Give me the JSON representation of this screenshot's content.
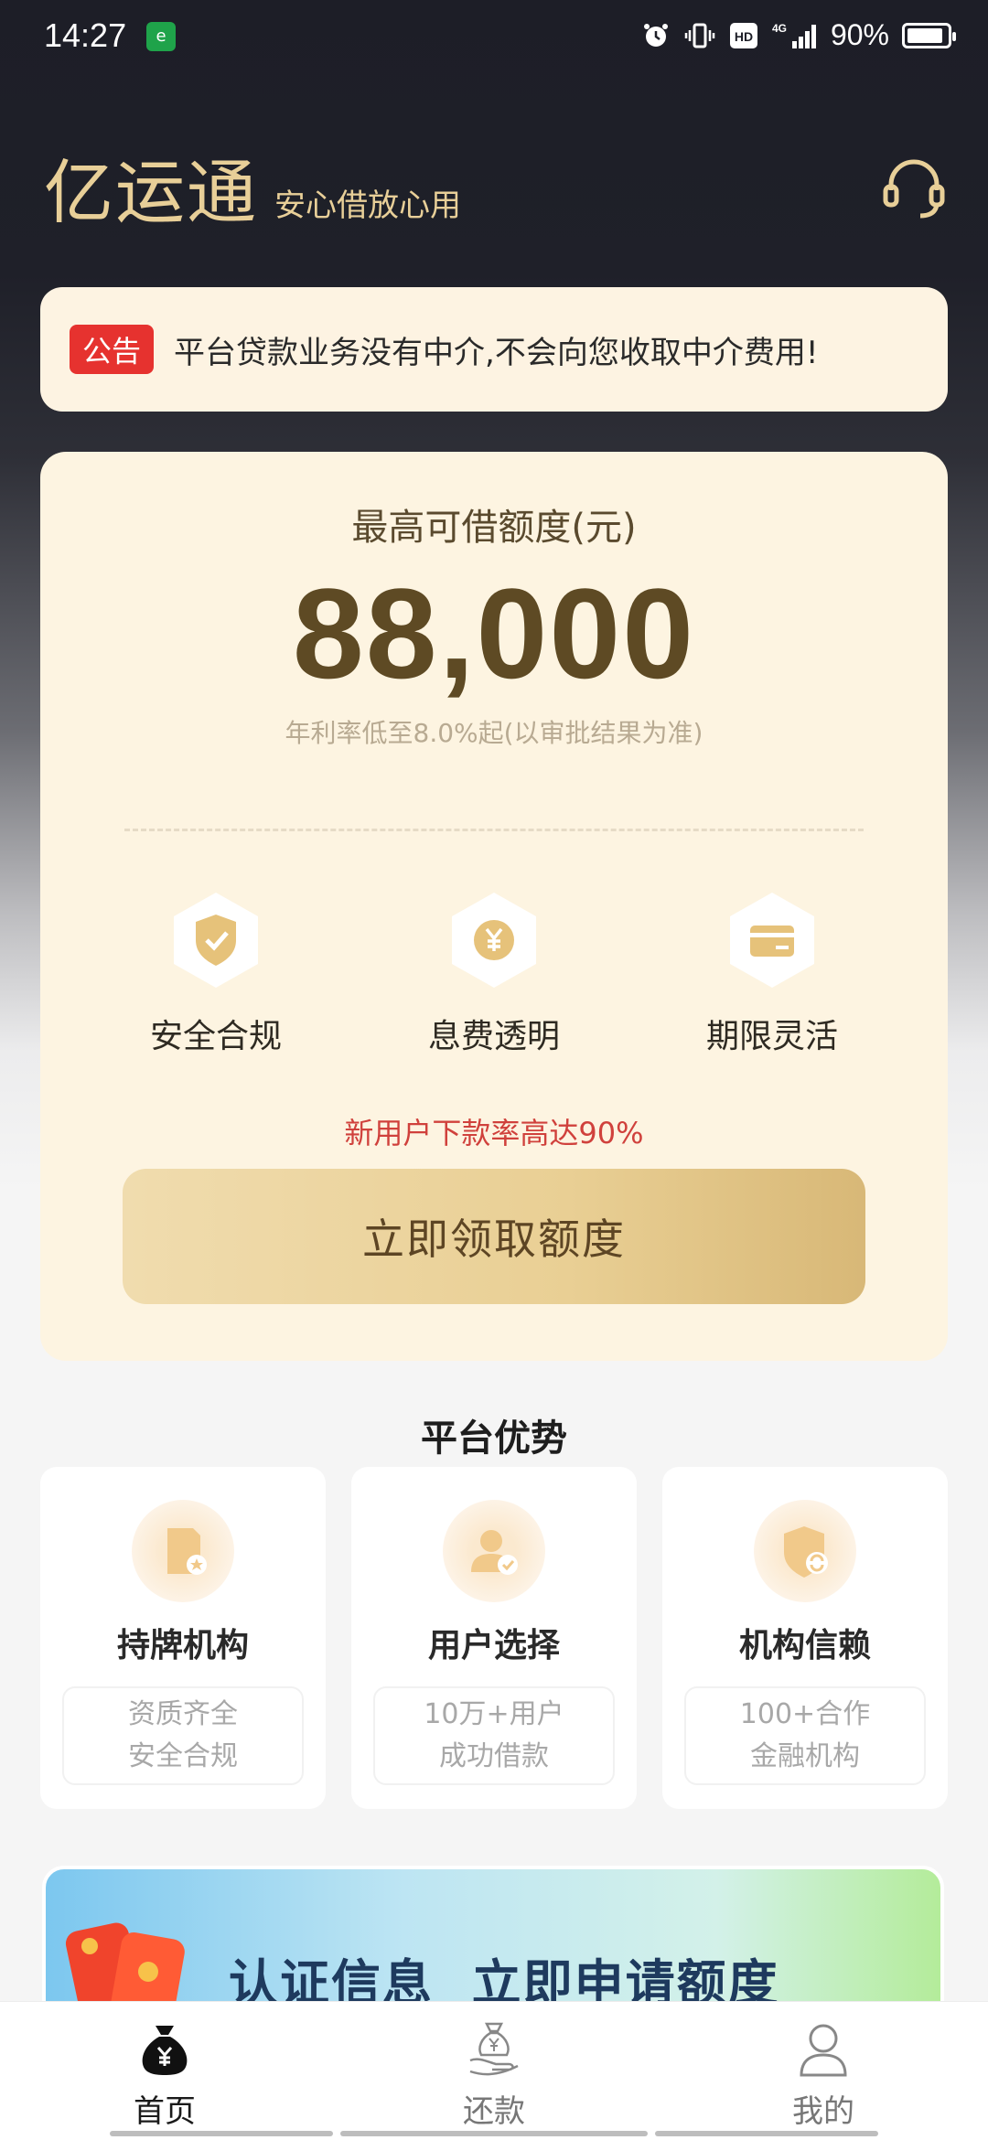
{
  "status_bar": {
    "time": "14:27",
    "battery_percent": "90%",
    "battery_level": 0.9
  },
  "header": {
    "app_name": "亿运通",
    "slogan": "安心借放心用"
  },
  "notice": {
    "tag": "公告",
    "text": "平台贷款业务没有中介,不会向您收取中介费用!"
  },
  "loan_card": {
    "title": "最高可借额度(元)",
    "amount": "88,000",
    "rate_note": "年利率低至8.0%起(以审批结果为准)",
    "features": [
      {
        "label": "安全合规",
        "icon": "shield-check-icon"
      },
      {
        "label": "息费透明",
        "icon": "yen-coin-icon"
      },
      {
        "label": "期限灵活",
        "icon": "card-icon"
      }
    ],
    "promo": "新用户下款率高达90%",
    "cta_label": "立即领取额度"
  },
  "advantages": {
    "title": "平台优势",
    "items": [
      {
        "name": "持牌机构",
        "desc_line1": "资质齐全",
        "desc_line2": "安全合规",
        "icon": "license-icon"
      },
      {
        "name": "用户选择",
        "desc_line1": "10万+用户",
        "desc_line2": "成功借款",
        "icon": "user-check-icon"
      },
      {
        "name": "机构信赖",
        "desc_line1": "100+合作",
        "desc_line2": "金融机构",
        "icon": "shield-exchange-icon"
      }
    ]
  },
  "banner": {
    "text": "认证信息  立即申请额度"
  },
  "bottom_nav": {
    "items": [
      {
        "label": "首页",
        "icon": "money-bag-icon",
        "active": true
      },
      {
        "label": "还款",
        "icon": "hand-coin-icon",
        "active": false
      },
      {
        "label": "我的",
        "icon": "person-icon",
        "active": false
      }
    ]
  },
  "colors": {
    "gold": "#e8cf98",
    "card_bg": "#fdf4e1",
    "red": "#e6322f",
    "amount": "#5e4a24"
  }
}
